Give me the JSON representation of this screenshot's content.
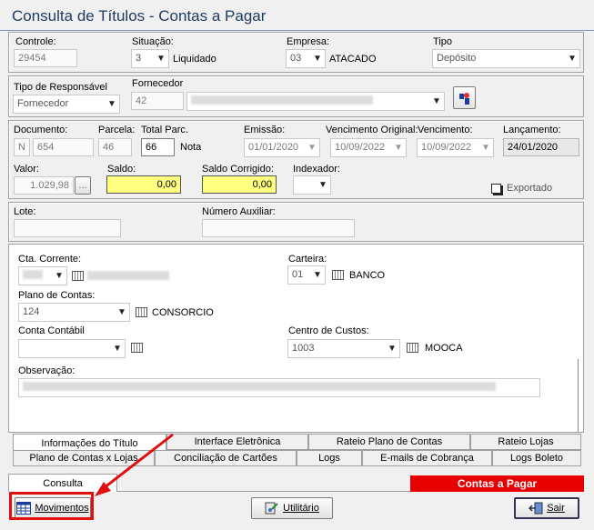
{
  "window": {
    "title": "Consulta de Títulos - Contas a Pagar"
  },
  "header": {
    "controle_label": "Controle:",
    "controle_value": "29454",
    "situacao_label": "Situação:",
    "situacao_value": "3",
    "situacao_text": "Liquidado",
    "empresa_label": "Empresa:",
    "empresa_value": "03",
    "empresa_text": "ATACADO",
    "tipo_label": "Tipo",
    "tipo_value": "Depósito"
  },
  "responsavel": {
    "tipo_label": "Tipo de Responsável",
    "tipo_value": "Fornecedor",
    "fornecedor_label": "Fornecedor",
    "fornecedor_code": "42"
  },
  "documento": {
    "documento_label": "Documento:",
    "doc_prefix": "N",
    "doc_value": "654",
    "parcela_label": "Parcela:",
    "parcela_value": "46",
    "total_label": "Total Parc.",
    "total_value": "66",
    "nota_label": "Nota",
    "emissao_label": "Emissão:",
    "emissao_value": "01/01/2020",
    "venc_orig_label": "Vencimento Original:",
    "venc_orig_value": "10/09/2022",
    "venc_label": "Vencimento:",
    "venc_value": "10/09/2022",
    "lanc_label": "Lançamento:",
    "lanc_value": "24/01/2020",
    "valor_label": "Valor:",
    "valor_value": "1.029,98",
    "valor_btn": "...",
    "saldo_label": "Saldo:",
    "saldo_value": "0,00",
    "saldo_corr_label": "Saldo Corrigido:",
    "saldo_corr_value": "0,00",
    "indexador_label": "Indexador:",
    "exportado_label": "Exportado"
  },
  "lote": {
    "lote_label": "Lote:",
    "num_aux_label": "Número Auxiliar:"
  },
  "info": {
    "cta_label": "Cta. Corrente:",
    "carteira_label": "Carteira:",
    "carteira_value": "01",
    "carteira_text": "BANCO",
    "plano_label": "Plano de Contas:",
    "plano_value": "124",
    "plano_text": "CONSORCIO",
    "contabil_label": "Conta Contábil",
    "centro_label": "Centro de Custos:",
    "centro_value": "1003",
    "centro_text": "MOOCA",
    "obs_label": "Observação:"
  },
  "tabs_row1": [
    "Interface Eletrônica",
    "Rateio Plano de Contas",
    "Rateio Lojas"
  ],
  "tabs_row2": [
    "Informações do Título",
    "Plano de Contas x Lojas",
    "Conciliação de Cartões",
    "Logs",
    "E-mails de Cobrança",
    "Logs Boleto"
  ],
  "bottom": {
    "consulta_tab": "Consulta",
    "contas_label": "Contas a Pagar",
    "movimentos_btn": "Movimentos",
    "utilitario_btn": "Utilitário",
    "sair_btn": "Sair"
  },
  "colors": {
    "highlight_red": "#e60000",
    "field_yellow": "#ffff80",
    "annotation_red": "#e01010"
  }
}
